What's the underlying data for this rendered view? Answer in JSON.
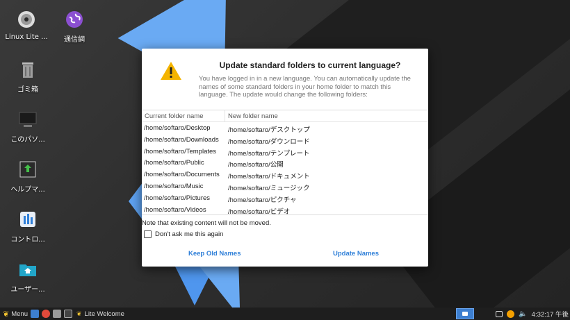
{
  "desktop": {
    "icons": [
      {
        "label": "Linux Lite ..."
      },
      {
        "label": "通信網"
      },
      {
        "label": "ゴミ箱"
      },
      {
        "label": "このパソ..."
      },
      {
        "label": "ヘルプマ..."
      },
      {
        "label": "コントロ..."
      },
      {
        "label": "ユーザー..."
      }
    ]
  },
  "dialog": {
    "title": "Update standard folders to current language?",
    "description": "You have logged in in a new language. You can automatically update the names of some standard folders in your home folder to match this language. The update would change the following folders:",
    "columns": [
      "Current folder name",
      "New folder name"
    ],
    "rows": [
      [
        "/home/softaro/Desktop",
        "/home/softaro/デスクトップ"
      ],
      [
        "/home/softaro/Downloads",
        "/home/softaro/ダウンロード"
      ],
      [
        "/home/softaro/Templates",
        "/home/softaro/テンプレート"
      ],
      [
        "/home/softaro/Public",
        "/home/softaro/公開"
      ],
      [
        "/home/softaro/Documents",
        "/home/softaro/ドキュメント"
      ],
      [
        "/home/softaro/Music",
        "/home/softaro/ミュージック"
      ],
      [
        "/home/softaro/Pictures",
        "/home/softaro/ピクチャ"
      ],
      [
        "/home/softaro/Videos",
        "/home/softaro/ビデオ"
      ]
    ],
    "note": "Note that existing content will not be moved.",
    "checkbox_label": "Don't ask me this again",
    "checkbox_checked": false,
    "keep_button": "Keep Old Names",
    "update_button": "Update Names",
    "accent_color": "#2f7fd8",
    "warning_color": "#f4b400"
  },
  "taskbar": {
    "menu_label": "Menu",
    "window_label": "Lite Welcome",
    "clock": "4:32:17 午後"
  }
}
